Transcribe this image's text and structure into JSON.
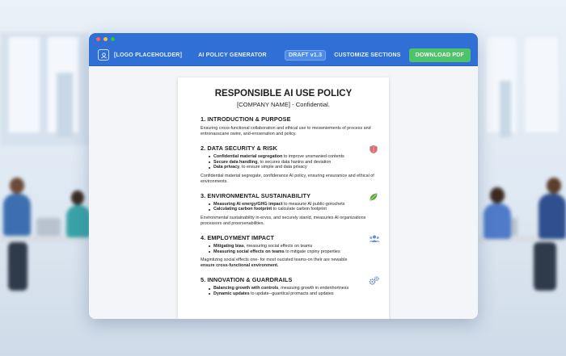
{
  "nav": {
    "logo": "[LOGO PLACEHOLDER]",
    "title": "AI POLICY GENERATOR",
    "draft": "DRAFT v1.3",
    "customize": "CUSTOMIZE SECTIONS",
    "download": "DOWNLOAD PDF"
  },
  "doc": {
    "title": "RESPONSIBLE AI USE POLICY",
    "subtitle": "[COMPANY NAME] - Confidential.",
    "sections": [
      {
        "heading": "1. INTRODUCTION & PURPOSE",
        "paragraph": "Ensuring cross-functional collaboration and ethical use to meswniements of process and entronasscane owire, and-erosenation and policy."
      },
      {
        "heading": "2. DATA SECURITY & RISK",
        "icon": "shield-icon",
        "bullets": [
          {
            "bold": "Confidential material segregation",
            "rest": " to improve unsmanied contents"
          },
          {
            "bold": "Secure data handling",
            "rest": ", to secures data hanins and deviation"
          },
          {
            "bold": "Data privacy",
            "rest": ", to ensure simple and data privacy"
          }
        ],
        "paragraph": "Confidential material segregate, confiderance AI policy, ensuring ensuranice and ethical of environments."
      },
      {
        "heading": "3. ENVIRONMENTAL SUSTAINABILITY",
        "icon": "leaf-icon",
        "bullets": [
          {
            "bold": "Measuring AI energy/GHG impact",
            "rest": " to measurie AI public-gorochets"
          },
          {
            "bold": "Calculating carbon footprint",
            "rest": " to calculate carbon footprint"
          }
        ],
        "paragraph": "Environmental sustainability in-ervss, and securely stanld, measuries AI organizations processors and proorsenabilities."
      },
      {
        "heading": "4. EMPLOYMENT IMPACT",
        "icon": "people-icon",
        "bullets": [
          {
            "bold": "Mitigating bias",
            "rest": ", measuring social effects on teams"
          },
          {
            "bold": "Measuring social effects on teams",
            "rest": " to mitigate cnpiny properties"
          }
        ],
        "paragraph_a": "Magintizing social effects one- for most oucisted teams-on their are newable",
        "paragraph_b": "ensure cross-functional environment."
      },
      {
        "heading": "5. INNOVATION & GUARDRAILS",
        "icon": "gears-icon",
        "bullets": [
          {
            "bold": "Balancing growth with controls",
            "rest": ", measuing growth in endenhortness"
          },
          {
            "bold": "Dynamic updates",
            "rest": " to update--guantical promacts and updates"
          }
        ]
      }
    ]
  },
  "colors": {
    "brand": "#2f6fd6",
    "download": "#4fc36a",
    "shield": "#e46a6a",
    "leaf": "#5aa83a",
    "people": "#5b8fd6",
    "gears": "#6b86b8"
  }
}
